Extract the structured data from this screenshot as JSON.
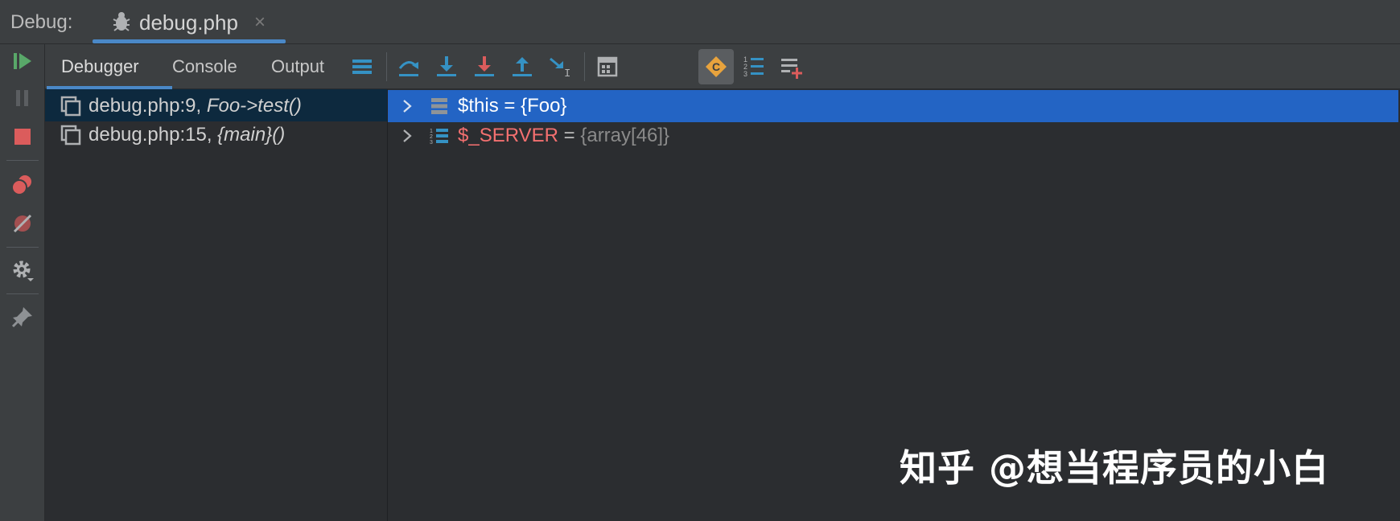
{
  "header": {
    "label": "Debug:",
    "tab": {
      "name": "debug.php",
      "close": "×",
      "icon": "bug-icon"
    }
  },
  "panel_tabs": [
    {
      "label": "Debugger",
      "active": true
    },
    {
      "label": "Console",
      "active": false
    },
    {
      "label": "Output",
      "active": false
    }
  ],
  "frames": [
    {
      "file": "debug.php:9, ",
      "func": "Foo->test()",
      "selected": true
    },
    {
      "file": "debug.php:15, ",
      "func": "{main}()",
      "selected": false
    }
  ],
  "variables": [
    {
      "name": "$this",
      "eq": " = ",
      "value": "{Foo}",
      "selected": true,
      "icon": "object-field-icon"
    },
    {
      "name": "$_SERVER",
      "eq": " = ",
      "value": "{array[46]}",
      "selected": false,
      "icon": "array-list-icon"
    }
  ],
  "watermark": "知乎 @想当程序员的小白",
  "colors": {
    "selected_row": "#2364c4",
    "accent_tab": "#4a88c7",
    "resume_green": "#59a869",
    "stop_red": "#db5c5c",
    "step_blue": "#3592c4"
  }
}
